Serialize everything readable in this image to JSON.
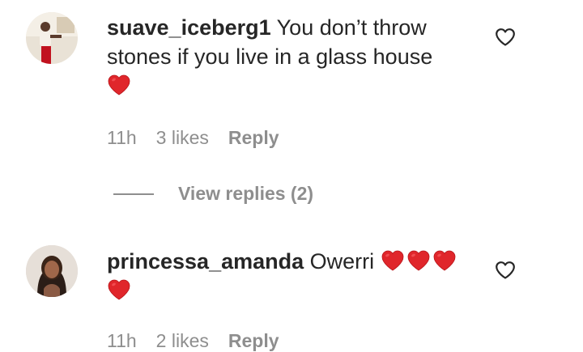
{
  "comments": [
    {
      "username": "suave_iceberg1",
      "text": "You don’t throw stones if you live in a glass house",
      "emoji": "❤️",
      "time": "11h",
      "likes": "3 likes",
      "reply_label": "Reply"
    },
    {
      "username": "princessa_amanda",
      "text": "Owerri",
      "emoji": "❤️❤️❤️❤️",
      "time": "11h",
      "likes": "2 likes",
      "reply_label": "Reply"
    }
  ],
  "view_replies_label": "View replies (2)",
  "icons": {
    "like": "heart-outline-icon",
    "emoji": "red-heart-emoji"
  },
  "colors": {
    "text": "#262626",
    "secondary": "#8e8e8e",
    "heart": "#e0262b"
  }
}
